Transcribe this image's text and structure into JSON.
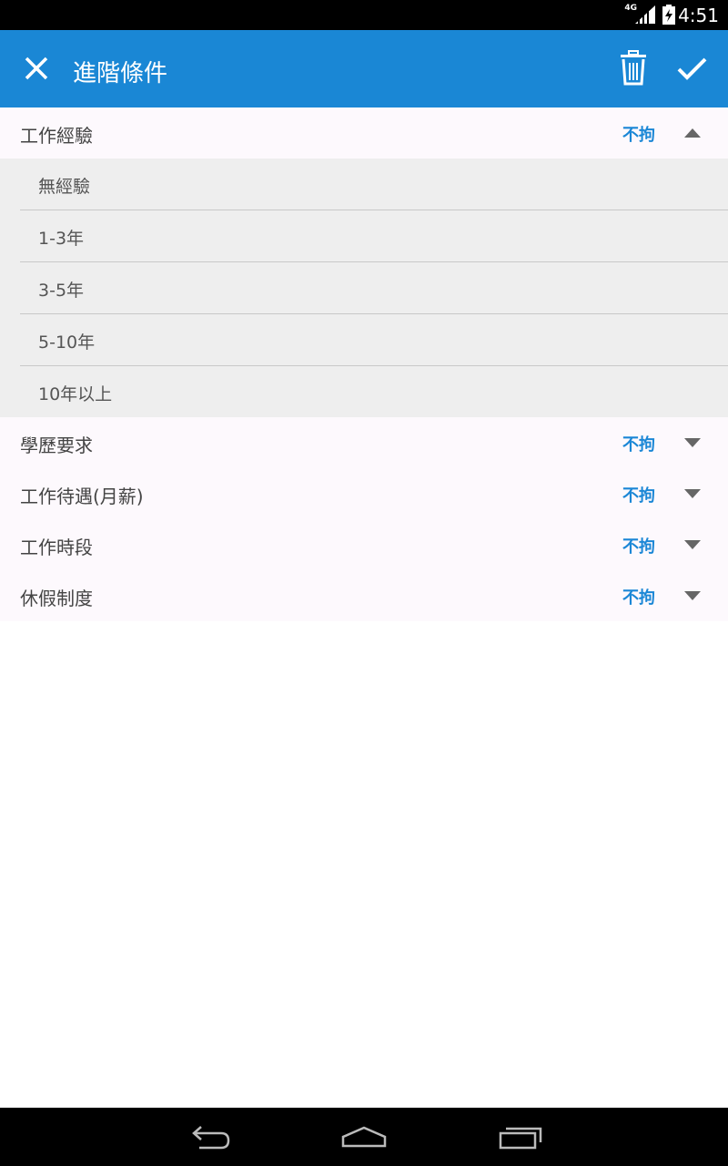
{
  "status_bar": {
    "network": "4G",
    "time": "4:51"
  },
  "app_bar": {
    "title": "進階條件",
    "close_icon": "close-icon",
    "delete_icon": "trash-icon",
    "confirm_icon": "check-icon"
  },
  "colors": {
    "primary": "#1a87d5",
    "accent_text": "#1b87d6",
    "option_bg": "#eeeeee"
  },
  "sections": [
    {
      "label": "工作經驗",
      "value": "不拘",
      "expanded": true,
      "options": [
        "無經驗",
        "1-3年",
        "3-5年",
        "5-10年",
        "10年以上"
      ]
    },
    {
      "label": "學歷要求",
      "value": "不拘",
      "expanded": false
    },
    {
      "label": "工作待遇(月薪)",
      "value": "不拘",
      "expanded": false
    },
    {
      "label": "工作時段",
      "value": "不拘",
      "expanded": false
    },
    {
      "label": "休假制度",
      "value": "不拘",
      "expanded": false
    }
  ]
}
